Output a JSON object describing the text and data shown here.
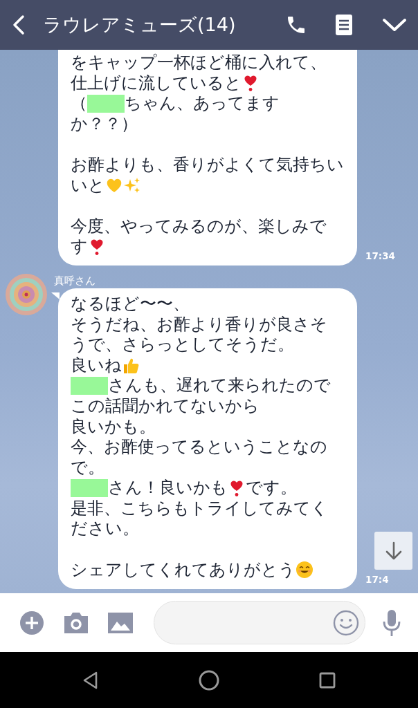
{
  "header": {
    "title": "ラウレアミューズ(14)"
  },
  "messages": [
    {
      "time": "17:34",
      "paragraphs": [
        [
          [
            {
              "kind": "text",
              "text": "をキャップ一杯ほど桶に入れて、"
            }
          ],
          [
            {
              "kind": "text",
              "text": "仕上げに流していると"
            },
            {
              "kind": "heart-exclamation"
            }
          ],
          [
            {
              "kind": "text",
              "text": "（"
            },
            {
              "kind": "redacted"
            },
            {
              "kind": "text",
              "text": "ちゃん、あってます"
            }
          ],
          [
            {
              "kind": "text",
              "text": "か？？）"
            }
          ]
        ],
        [
          [
            {
              "kind": "text",
              "text": "お酢よりも、香りがよくて気持ちい"
            }
          ],
          [
            {
              "kind": "text",
              "text": "いと"
            },
            {
              "kind": "yellow-heart"
            },
            {
              "kind": "sparkles"
            }
          ]
        ],
        [
          [
            {
              "kind": "text",
              "text": "今度、やってみるのが、楽しみで"
            }
          ],
          [
            {
              "kind": "text",
              "text": "す"
            },
            {
              "kind": "heart-exclamation"
            }
          ]
        ]
      ]
    },
    {
      "sender": "真呼さん",
      "time": "17:4",
      "paragraphs": [
        [
          [
            {
              "kind": "text",
              "text": "なるほど〜〜、"
            }
          ],
          [
            {
              "kind": "text",
              "text": "そうだね、お酢より香りが良さそ"
            }
          ],
          [
            {
              "kind": "text",
              "text": "うで、さらっとしてそうだ。"
            }
          ],
          [
            {
              "kind": "text",
              "text": "良いね"
            },
            {
              "kind": "thumbs-up"
            }
          ],
          [
            {
              "kind": "redacted"
            },
            {
              "kind": "text",
              "text": "さんも、遅れて来られたので"
            }
          ],
          [
            {
              "kind": "text",
              "text": "この話聞かれてないから"
            }
          ],
          [
            {
              "kind": "text",
              "text": "良いかも。"
            }
          ],
          [
            {
              "kind": "text",
              "text": "今、お酢使ってるということなの"
            }
          ],
          [
            {
              "kind": "text",
              "text": "で。"
            }
          ],
          [
            {
              "kind": "redacted"
            },
            {
              "kind": "text",
              "text": "さん！良いかも"
            },
            {
              "kind": "heart-exclamation"
            },
            {
              "kind": "text",
              "text": "です。"
            }
          ],
          [
            {
              "kind": "text",
              "text": "是非、こちらもトライしてみてく"
            }
          ],
          [
            {
              "kind": "text",
              "text": "ださい。"
            }
          ]
        ],
        [
          [
            {
              "kind": "text",
              "text": "シェアしてくれてありがとう"
            },
            {
              "kind": "smile"
            }
          ]
        ]
      ]
    }
  ]
}
